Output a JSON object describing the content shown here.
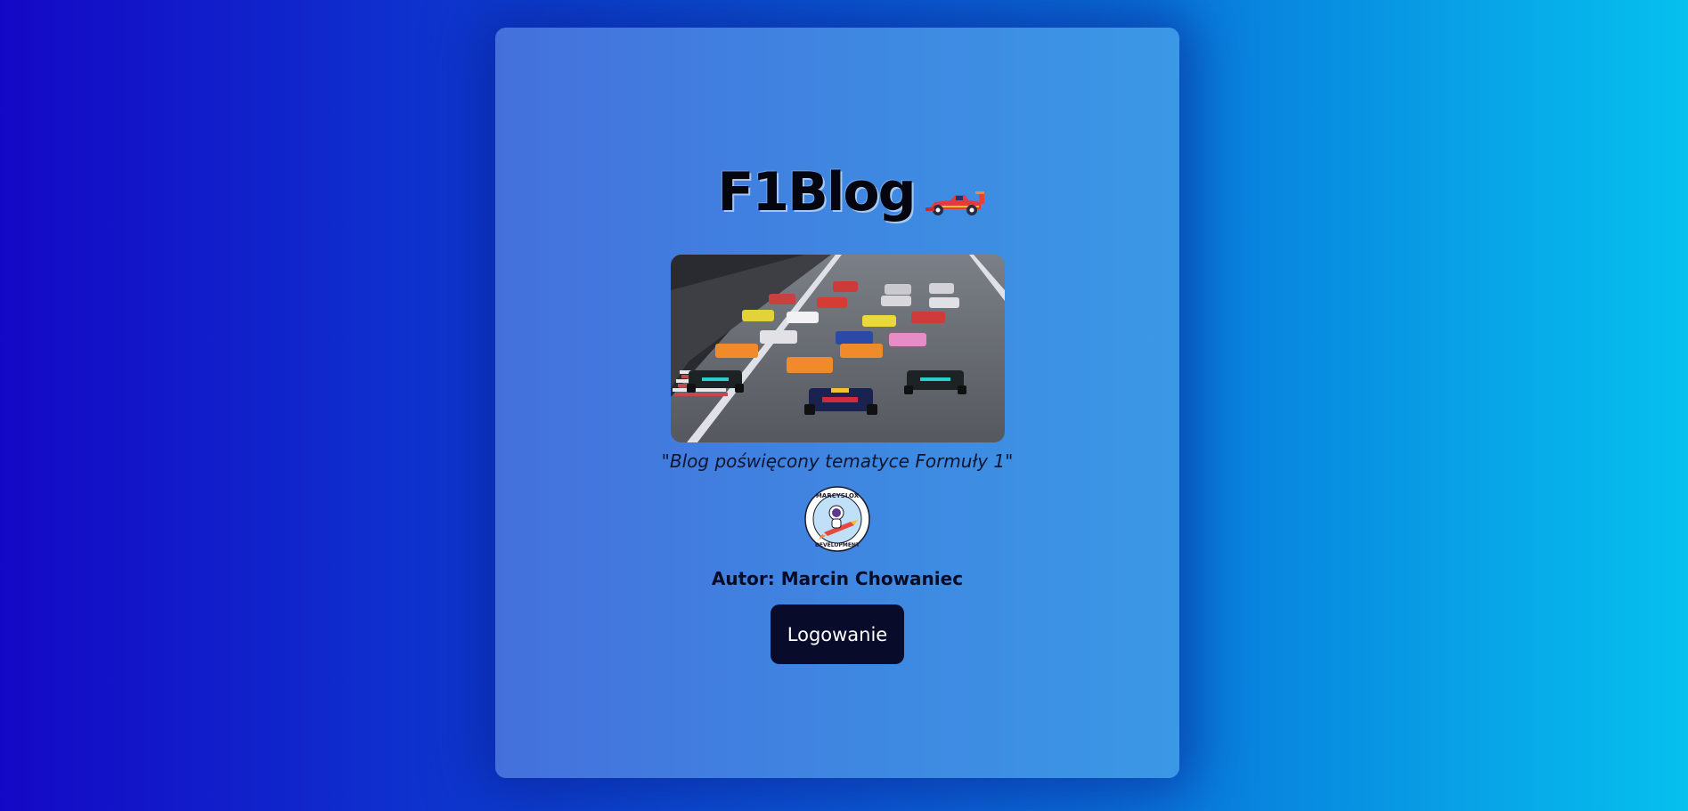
{
  "header": {
    "title": "F1Blog",
    "title_icon": "race-car-icon"
  },
  "hero": {
    "image": "f1-race-start-photo"
  },
  "tagline": "\"Blog poświęcony tematyce Formuły 1\"",
  "logo": {
    "image": "marcyslox-development-logo",
    "text_top": "MARCYSLOX",
    "text_bottom": "DEVELOPMENT"
  },
  "author": "Autor: Marcin Chowaniec",
  "actions": {
    "login_label": "Logowanie"
  },
  "colors": {
    "background_start": "#1408c6",
    "background_end": "#06c0ee",
    "card": "#3f86e1",
    "button": "#090b2a"
  }
}
